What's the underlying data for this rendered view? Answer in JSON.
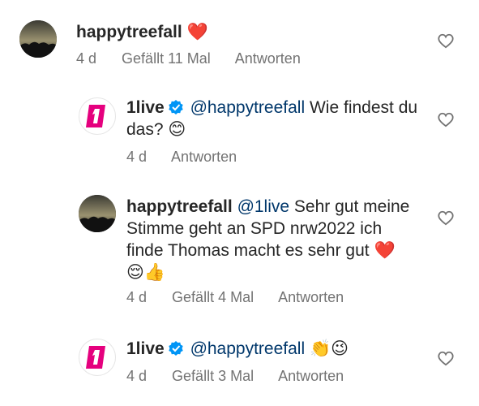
{
  "comments": [
    {
      "username": "happytreefall",
      "mention": "",
      "text": "",
      "emoji": "❤️",
      "time": "4 d",
      "likes": "Gefällt 11 Mal",
      "reply_label": "Antworten"
    },
    {
      "username": "1live",
      "mention": "@happytreefall",
      "text": "Wie findest du das?",
      "emoji": "😊",
      "time": "4 d",
      "likes": "",
      "reply_label": "Antworten"
    },
    {
      "username": "happytreefall",
      "mention": "@1live",
      "text_line1": "Sehr gut meine",
      "text_line2": "Stimme geht an SPD nrw2022 ich",
      "text_line3": "finde Thomas macht es sehr gut",
      "emoji_heart": "❤️",
      "emoji_line4": "😌👍",
      "time": "4 d",
      "likes": "Gefällt 4 Mal",
      "reply_label": "Antworten"
    },
    {
      "username": "1live",
      "mention": "@happytreefall",
      "emoji": "👏😉",
      "time": "4 d",
      "likes": "Gefällt 3 Mal",
      "reply_label": "Antworten"
    }
  ],
  "colors": {
    "text": "#262626",
    "meta": "#737373",
    "mention": "#00376b",
    "verified": "#0095f6",
    "heart": "#ed1c24",
    "logo_pink": "#e5007e"
  },
  "icons": {
    "like": "heart-outline-icon",
    "verified": "verified-badge-icon"
  }
}
